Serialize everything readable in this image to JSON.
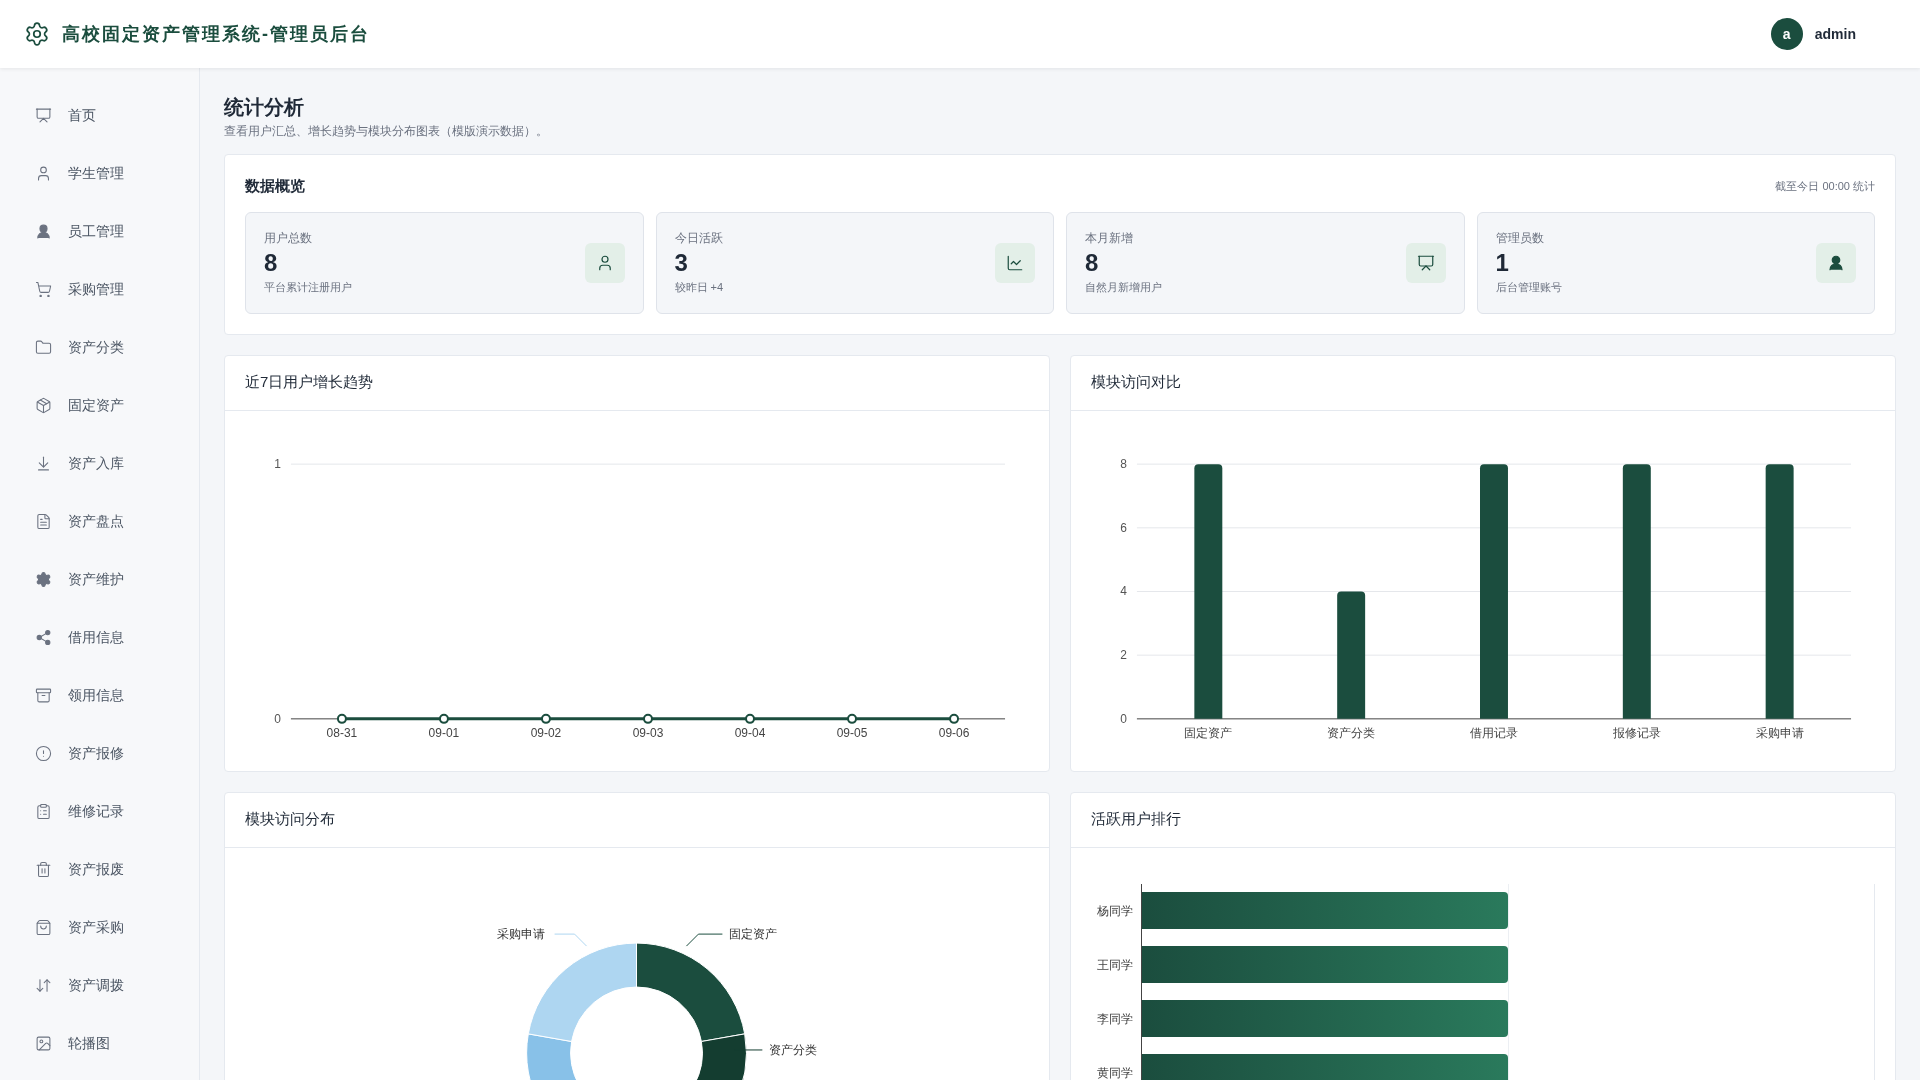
{
  "header": {
    "title": "高校固定资产管理系统-管理员后台",
    "user": {
      "avatar": "a",
      "name": "admin"
    }
  },
  "sidebar": {
    "items": [
      {
        "label": "首页",
        "selected": false
      },
      {
        "label": "学生管理",
        "selected": false
      },
      {
        "label": "员工管理",
        "selected": false
      },
      {
        "label": "采购管理",
        "selected": false
      },
      {
        "label": "资产分类",
        "selected": false
      },
      {
        "label": "固定资产",
        "selected": false
      },
      {
        "label": "资产入库",
        "selected": false
      },
      {
        "label": "资产盘点",
        "selected": false
      },
      {
        "label": "资产维护",
        "selected": false
      },
      {
        "label": "借用信息",
        "selected": false
      },
      {
        "label": "领用信息",
        "selected": false
      },
      {
        "label": "资产报修",
        "selected": false
      },
      {
        "label": "维修记录",
        "selected": false
      },
      {
        "label": "资产报废",
        "selected": false
      },
      {
        "label": "资产采购",
        "selected": false
      },
      {
        "label": "资产调拨",
        "selected": false
      },
      {
        "label": "轮播图",
        "selected": false
      }
    ]
  },
  "page": {
    "title": "统计分析",
    "subtitle": "查看用户汇总、增长趋势与模块分布图表（模版演示数据）。"
  },
  "overview": {
    "title": "数据概览",
    "note": "截至今日 00:00 统计",
    "stats": [
      {
        "label": "用户总数",
        "value": "8",
        "caption": "平台累计注册用户"
      },
      {
        "label": "今日活跃",
        "value": "3",
        "caption": "较昨日 +4"
      },
      {
        "label": "本月新增",
        "value": "8",
        "caption": "自然月新增用户"
      },
      {
        "label": "管理员数",
        "value": "1",
        "caption": "后台管理账号"
      }
    ]
  },
  "growth_chart": {
    "title": "近7日用户增长趋势",
    "chart_data": {
      "type": "line",
      "categories": [
        "08-31",
        "09-01",
        "09-02",
        "09-03",
        "09-04",
        "09-05",
        "09-06"
      ],
      "series": [
        {
          "color": "#1b4d3e",
          "marker": "circle",
          "values": [
            0,
            0,
            0,
            0,
            0,
            0,
            0
          ]
        }
      ],
      "ylim": [
        0,
        1
      ],
      "yticks": [
        0,
        1
      ],
      "grid": true
    }
  },
  "module_chart": {
    "title": "模块访问对比",
    "chart_data": {
      "type": "bar",
      "categories": [
        "固定资产",
        "资产分类",
        "借用记录",
        "报修记录",
        "采购申请"
      ],
      "series": [
        {
          "color": "#1b4d3e",
          "values": [
            8,
            4,
            8,
            8,
            8
          ]
        }
      ],
      "ylim": [
        0,
        8
      ],
      "yticks": [
        0,
        2,
        4,
        6,
        8
      ],
      "grid": true
    }
  },
  "distribution_chart": {
    "title": "模块访问分布",
    "slice_labels": [
      "采购申请",
      "固定资产",
      "资产分类"
    ]
  },
  "ranking": {
    "title": "活跃用户排行",
    "rows": [
      {
        "name": "杨同学"
      },
      {
        "name": "王同学"
      },
      {
        "name": "李同学"
      },
      {
        "name": "黄同学"
      }
    ]
  }
}
